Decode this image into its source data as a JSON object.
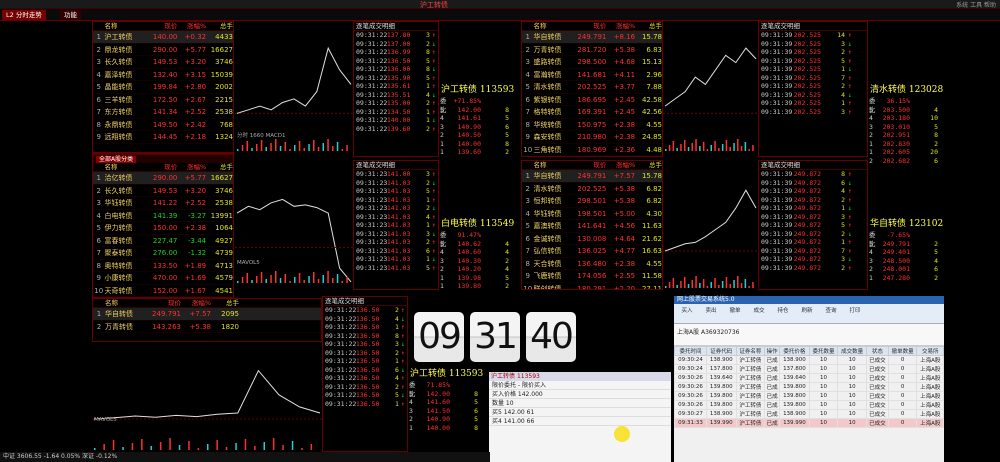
{
  "window": {
    "title": "沪工转债",
    "top_right": "系统 工具 帮助"
  },
  "tabs": [
    "L2 分时走势",
    "功能",
    "上证",
    "更多"
  ],
  "quote_header": [
    "名称",
    "现价",
    "涨幅%",
    "总手"
  ],
  "list1": [
    {
      "n": "沪工转债",
      "p": "140.00",
      "c": "+0.32",
      "v": "4433"
    },
    {
      "n": "鼎龙转债",
      "p": "290.00",
      "c": "+5.77",
      "v": "16627"
    },
    {
      "n": "长久转债",
      "p": "149.53",
      "c": "+3.20",
      "v": "3746"
    },
    {
      "n": "嘉泽转债",
      "p": "132.40",
      "c": "+3.15",
      "v": "15039"
    },
    {
      "n": "晶能转债",
      "p": "199.84",
      "c": "+2.80",
      "v": "2002"
    },
    {
      "n": "三羊转债",
      "p": "172.50",
      "c": "+2.67",
      "v": "2215"
    },
    {
      "n": "东方转债",
      "p": "141.34",
      "c": "+2.52",
      "v": "2538"
    },
    {
      "n": "永鼎转债",
      "p": "149.50",
      "c": "+2.42",
      "v": "768"
    },
    {
      "n": "远翔转债",
      "p": "144.45",
      "c": "+2.18",
      "v": "1324"
    }
  ],
  "list2": [
    {
      "n": "洽亿转债",
      "p": "290.00",
      "c": "+5.77",
      "v": "16627"
    },
    {
      "n": "长久转债",
      "p": "149.53",
      "c": "+3.20",
      "v": "3746"
    },
    {
      "n": "华钰转债",
      "p": "141.22",
      "c": "+2.52",
      "v": "2538"
    },
    {
      "n": "白电转债",
      "p": "141.39",
      "c": "-3.27",
      "v": "13991"
    },
    {
      "n": "伊力转债",
      "p": "150.00",
      "c": "+2.38",
      "v": "1064"
    },
    {
      "n": "富春转债",
      "p": "227.47",
      "c": "-3.44",
      "v": "4927"
    },
    {
      "n": "聚泰转债",
      "p": "276.00",
      "c": "-1.32",
      "v": "4739"
    },
    {
      "n": "奥特转债",
      "p": "133.50",
      "c": "+1.89",
      "v": "4713"
    },
    {
      "n": "小康转债",
      "p": "470.00",
      "c": "+1.69",
      "v": "4579"
    },
    {
      "n": "天奇转债",
      "p": "152.00",
      "c": "+1.67",
      "v": "4541"
    }
  ],
  "list3": [
    {
      "n": "华自转债",
      "p": "249.791",
      "c": "+7.57",
      "v": "2095"
    },
    {
      "n": "万青转债",
      "p": "143.263",
      "c": "+5.38",
      "v": "1820"
    }
  ],
  "list4": [
    {
      "n": "华自转债",
      "p": "249.791",
      "c": "+8.16",
      "v": "15.78"
    },
    {
      "n": "万青转债",
      "p": "281.720",
      "c": "+5.38",
      "v": "6.83"
    },
    {
      "n": "盛路转债",
      "p": "298.500",
      "c": "+4.68",
      "v": "15.13"
    },
    {
      "n": "富瀚转债",
      "p": "141.681",
      "c": "+4.11",
      "v": "2.96"
    },
    {
      "n": "清水转债",
      "p": "202.525",
      "c": "+3.77",
      "v": "7.88"
    },
    {
      "n": "紫银转债",
      "p": "186.695",
      "c": "+2.45",
      "v": "42.58"
    },
    {
      "n": "格特转债",
      "p": "169.391",
      "c": "+2.45",
      "v": "42.56"
    },
    {
      "n": "华统转债",
      "p": "150.975",
      "c": "+2.38",
      "v": "4.55"
    },
    {
      "n": "森安转债",
      "p": "210.980",
      "c": "+2.38",
      "v": "24.85"
    },
    {
      "n": "三角转债",
      "p": "180.969",
      "c": "+2.36",
      "v": "4.48"
    }
  ],
  "list5": [
    {
      "n": "华自转债",
      "p": "249.791",
      "c": "+7.57",
      "v": "15.78"
    },
    {
      "n": "清水转债",
      "p": "202.525",
      "c": "+5.38",
      "v": "6.82"
    },
    {
      "n": "恒邦转债",
      "p": "298.501",
      "c": "+5.38",
      "v": "6.82"
    },
    {
      "n": "华钰转债",
      "p": "198.501",
      "c": "+5.00",
      "v": "4.30"
    },
    {
      "n": "嘉澳转债",
      "p": "141.641",
      "c": "+4.56",
      "v": "11.63"
    },
    {
      "n": "金诚转债",
      "p": "130.008",
      "c": "+4.64",
      "v": "21.62"
    },
    {
      "n": "弘信转债",
      "p": "136.025",
      "c": "+4.77",
      "v": "16.63"
    },
    {
      "n": "天合转债",
      "p": "136.480",
      "c": "+2.38",
      "v": "4.55"
    },
    {
      "n": "飞鹿转债",
      "p": "174.056",
      "c": "+2.55",
      "v": "11.58"
    },
    {
      "n": "联创转债",
      "p": "180.291",
      "c": "+2.20",
      "v": "27.11"
    },
    {
      "n": "永大转债",
      "p": "129.400",
      "c": "+2.11",
      "v": "6.56"
    }
  ],
  "subtab_label": "全部A股分类",
  "chart_label": "分时 1660 MACD1",
  "vol_label": "MAVOL5",
  "tick_header": "逐笔成交明细",
  "ticks_a": [
    [
      "09:31:22",
      "137.80",
      "3"
    ],
    [
      "09:31:22",
      "137.00",
      "2"
    ],
    [
      "09:31:22",
      "136.99",
      "8"
    ],
    [
      "09:31:22",
      "136.50",
      "5"
    ],
    [
      "09:31:22",
      "136.00",
      "8"
    ],
    [
      "09:31:22",
      "135.90",
      "5"
    ],
    [
      "09:31:22",
      "135.61",
      "1"
    ],
    [
      "09:31:22",
      "135.51",
      "4"
    ],
    [
      "09:31:22",
      "135.00",
      "2"
    ],
    [
      "09:31:22",
      "134.50",
      "1"
    ],
    [
      "09:31:22",
      "140.00",
      "1"
    ],
    [
      "09:31:22",
      "139.60",
      "2"
    ]
  ],
  "ticks_b": [
    [
      "09:31:23",
      "141.00",
      "3"
    ],
    [
      "09:31:23",
      "141.03",
      "2"
    ],
    [
      "09:31:23",
      "141.03",
      "5"
    ],
    [
      "09:31:23",
      "141.03",
      "1"
    ],
    [
      "09:31:23",
      "141.03",
      "2"
    ],
    [
      "09:31:23",
      "141.03",
      "4"
    ],
    [
      "09:31:23",
      "141.03",
      "1"
    ],
    [
      "09:31:23",
      "141.03",
      "3"
    ],
    [
      "09:31:23",
      "141.03",
      "2"
    ],
    [
      "09:31:23",
      "141.03",
      "6"
    ],
    [
      "09:31:23",
      "141.03",
      "1"
    ],
    [
      "09:31:23",
      "141.03",
      "5"
    ]
  ],
  "ticks_c": [
    [
      "09:31:22",
      "136.50",
      "2"
    ],
    [
      "09:31:22",
      "136.50",
      "4"
    ],
    [
      "09:31:22",
      "136.50",
      "1"
    ],
    [
      "09:31:22",
      "136.50",
      "8"
    ],
    [
      "09:31:22",
      "136.50",
      "3"
    ],
    [
      "09:31:22",
      "136.50",
      "2"
    ],
    [
      "09:31:22",
      "136.50",
      "1"
    ],
    [
      "09:31:22",
      "136.50",
      "6"
    ],
    [
      "09:31:22",
      "136.50",
      "4"
    ],
    [
      "09:31:22",
      "136.50",
      "2"
    ],
    [
      "09:31:22",
      "136.50",
      "5"
    ],
    [
      "09:31:22",
      "136.50",
      "1"
    ]
  ],
  "ticks_d": [
    [
      "09:31:39",
      "202.525",
      "14"
    ],
    [
      "09:31:39",
      "202.525",
      "3"
    ],
    [
      "09:31:39",
      "202.525",
      "2"
    ],
    [
      "09:31:39",
      "202.525",
      "5"
    ],
    [
      "09:31:39",
      "202.525",
      "1"
    ],
    [
      "09:31:39",
      "202.525",
      "7"
    ],
    [
      "09:31:39",
      "202.525",
      "2"
    ],
    [
      "09:31:39",
      "202.525",
      "4"
    ],
    [
      "09:31:39",
      "202.525",
      "1"
    ],
    [
      "09:31:39",
      "202.525",
      "3"
    ]
  ],
  "ticks_e": [
    [
      "09:31:39",
      "249.872",
      "8"
    ],
    [
      "09:31:39",
      "249.872",
      "6"
    ],
    [
      "09:31:39",
      "249.872",
      "4"
    ],
    [
      "09:31:39",
      "249.872",
      "2"
    ],
    [
      "09:31:39",
      "249.872",
      "1"
    ],
    [
      "09:31:39",
      "249.872",
      "3"
    ],
    [
      "09:31:39",
      "249.872",
      "5"
    ],
    [
      "09:31:39",
      "249.872",
      "2"
    ],
    [
      "09:31:39",
      "249.872",
      "1"
    ],
    [
      "09:31:39",
      "249.872",
      "7"
    ],
    [
      "09:31:39",
      "249.872",
      "3"
    ],
    [
      "09:31:39",
      "249.872",
      "2"
    ]
  ],
  "side_a": {
    "name": "沪工转债 113593",
    "rows": [
      [
        "5",
        "142.00",
        "8"
      ],
      [
        "4",
        "141.61",
        "5"
      ],
      [
        "3",
        "140.90",
        "6"
      ],
      [
        "2",
        "140.50",
        "5"
      ],
      [
        "1",
        "140.00",
        "8"
      ],
      [
        "1",
        "139.60",
        "2"
      ]
    ],
    "ratio": "+71.85%"
  },
  "side_b": {
    "name": "白电转债 113549",
    "rows": [
      [
        "5",
        "140.62",
        "4"
      ],
      [
        "4",
        "140.60",
        "4"
      ],
      [
        "3",
        "140.30",
        "2"
      ],
      [
        "2",
        "140.20",
        "4"
      ],
      [
        "1",
        "139.98",
        "5"
      ],
      [
        "1",
        "139.80",
        "2"
      ]
    ],
    "ratio": "91.47%"
  },
  "side_c": {
    "name": "沪工转债 113593",
    "rows": [
      [
        "5",
        "142.00",
        "8"
      ],
      [
        "4",
        "141.60",
        "5"
      ],
      [
        "3",
        "141.50",
        "6"
      ],
      [
        "2",
        "140.90",
        "5"
      ],
      [
        "1",
        "140.00",
        "8"
      ]
    ],
    "ratio": "71.85%"
  },
  "side_d": {
    "name": "清水转债 123028",
    "rows": [
      [
        "5",
        "203.500",
        "4"
      ],
      [
        "4",
        "203.180",
        "10"
      ],
      [
        "3",
        "203.010",
        "5"
      ],
      [
        "2",
        "202.951",
        "8"
      ],
      [
        "1",
        "202.830",
        "2"
      ],
      [
        "1",
        "202.605",
        "20"
      ],
      [
        "2",
        "202.682",
        "6"
      ]
    ],
    "ratio": "36.15%"
  },
  "side_e": {
    "name": "华自转债 123102",
    "rows": [
      [
        "5",
        "249.791",
        "2"
      ],
      [
        "4",
        "249.401",
        "5"
      ],
      [
        "3",
        "248.500",
        "4"
      ],
      [
        "2",
        "248.001",
        "6"
      ],
      [
        "1",
        "247.280",
        "2"
      ]
    ],
    "ratio": "-7.65%"
  },
  "clock": {
    "h": "09",
    "m": "31",
    "s": "40"
  },
  "trade": {
    "title": "网上股票交易系统5.0",
    "tools": [
      "买入",
      "卖出",
      "撤单",
      "成交",
      "持仓",
      "刷新",
      "查询",
      "打印"
    ],
    "form": "上海A股  A369320736",
    "cols": [
      "委托时间",
      "证券代码",
      "证券名称",
      "操作",
      "委托价格",
      "委托数量",
      "成交数量",
      "状态",
      "撤单数量",
      "交易所"
    ],
    "rows": [
      [
        "09:30:24",
        "138.900",
        "沪工转债",
        "已成",
        "138.900",
        "10",
        "10",
        "已成交",
        "0",
        "上海A股"
      ],
      [
        "09:30:24",
        "137.800",
        "沪工转债",
        "已成",
        "137.800",
        "10",
        "10",
        "已成交",
        "0",
        "上海A股"
      ],
      [
        "09:30:26",
        "139.640",
        "沪工转债",
        "已成",
        "139.640",
        "10",
        "10",
        "已成交",
        "0",
        "上海A股"
      ],
      [
        "09:30:26",
        "139.800",
        "沪工转债",
        "已成",
        "139.800",
        "10",
        "10",
        "已成交",
        "0",
        "上海A股"
      ],
      [
        "09:30:26",
        "139.800",
        "沪工转债",
        "已成",
        "139.800",
        "10",
        "10",
        "已成交",
        "0",
        "上海A股"
      ],
      [
        "09:30:26",
        "139.800",
        "沪工转债",
        "已成",
        "139.800",
        "10",
        "10",
        "已成交",
        "0",
        "上海A股"
      ],
      [
        "09:30:27",
        "138.900",
        "沪工转债",
        "已成",
        "138.900",
        "10",
        "10",
        "已成交",
        "0",
        "上海A股"
      ],
      [
        "09:31:33",
        "139.990",
        "沪工转债",
        "已成",
        "139.990",
        "10",
        "10",
        "已成交",
        "0",
        "上海A股"
      ]
    ]
  },
  "order": {
    "title": "沪工转债",
    "code": "113593",
    "rows": [
      "限价委托 - 限价买入",
      "买入价格  142.000",
      "数量 10",
      "买5 142.00  61",
      "买4 141.00  66"
    ]
  },
  "status": "中证  3606.55  -1.64  0.05%  深证  -0.12%"
}
